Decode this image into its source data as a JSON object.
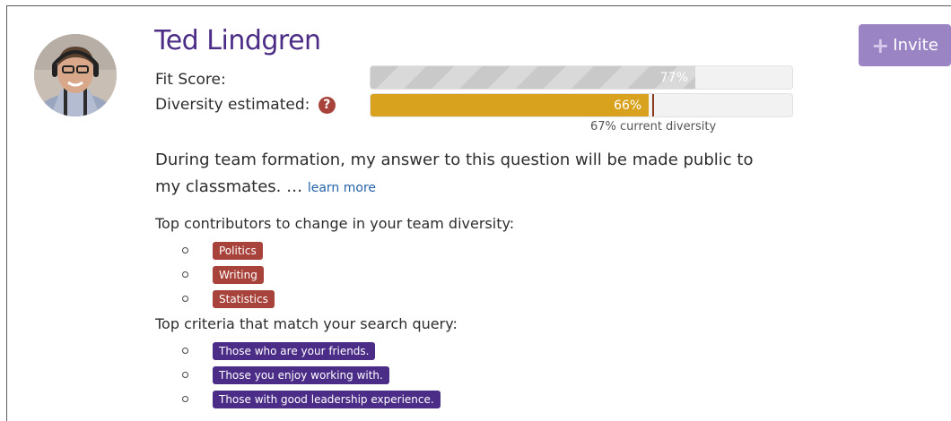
{
  "profile": {
    "name": "Ted Lindgren",
    "fit_label": "Fit Score:",
    "fit_score": 77,
    "fit_score_text": "77%",
    "diversity_label": "Diversity estimated:",
    "diversity_estimated": 66,
    "diversity_estimated_text": "66%",
    "current_diversity": 67,
    "current_diversity_text": "67% current diversity"
  },
  "invite_button": {
    "label": "Invite",
    "icon": "plus-icon"
  },
  "description": {
    "text": "During team formation, my answer to this question will be made public to my classmates. … ",
    "link": "learn more"
  },
  "contributors": {
    "title": "Top contributors to change in your team diversity:",
    "tags": [
      "Politics",
      "Writing",
      "Statistics"
    ]
  },
  "criteria": {
    "title": "Top criteria that match your search query:",
    "tags": [
      "Those who are your friends.",
      "Those you enjoy working with.",
      "Those with good leadership experience."
    ]
  },
  "colors": {
    "name": "#4b2c86",
    "diversity_fill": "#d9a21e",
    "contributor_tag": "#a8433c",
    "criteria_tag": "#4b2c86",
    "invite_button": "#9b84c3"
  }
}
